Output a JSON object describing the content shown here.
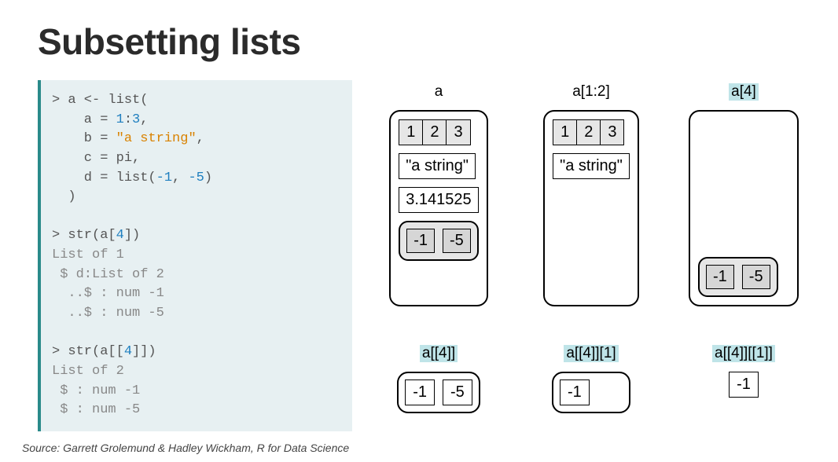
{
  "title": "Subsetting lists",
  "code": {
    "l1a": "> a <- list(",
    "l2a": "    a = ",
    "l2b": "1",
    "l2c": ":",
    "l2d": "3",
    "l2e": ",",
    "l3a": "    b = ",
    "l3b": "\"a string\"",
    "l3c": ",",
    "l4a": "    c = pi,",
    "l5a": "    d = list(",
    "l5b": "-1",
    "l5c": ", ",
    "l5d": "-5",
    "l5e": ")",
    "l6a": "  )",
    "l8a": "> str(a[",
    "l8b": "4",
    "l8c": "])",
    "l9": "List of 1",
    "l10": " $ d:List of 2",
    "l11": "  ..$ : num -1",
    "l12": "  ..$ : num -5",
    "l14a": "> str(a[[",
    "l14b": "4",
    "l14c": "]])",
    "l15": "List of 2",
    "l16": " $ : num -1",
    "l17": " $ : num -5"
  },
  "labels": {
    "a": "a",
    "a12": "a[1:2]",
    "a4": "a[4]",
    "adbl4": "a[[4]]",
    "adbl4_1": "a[[4]][1]",
    "adbl4_dbl1": "a[[4]][[1]]"
  },
  "values": {
    "string": "\"a string\"",
    "pi": "3.141525",
    "n1": "1",
    "n2": "2",
    "n3": "3",
    "m1": "-1",
    "m5": "-5"
  },
  "source": "Source: Garrett Grolemund & Hadley Wickham, R for Data Science"
}
